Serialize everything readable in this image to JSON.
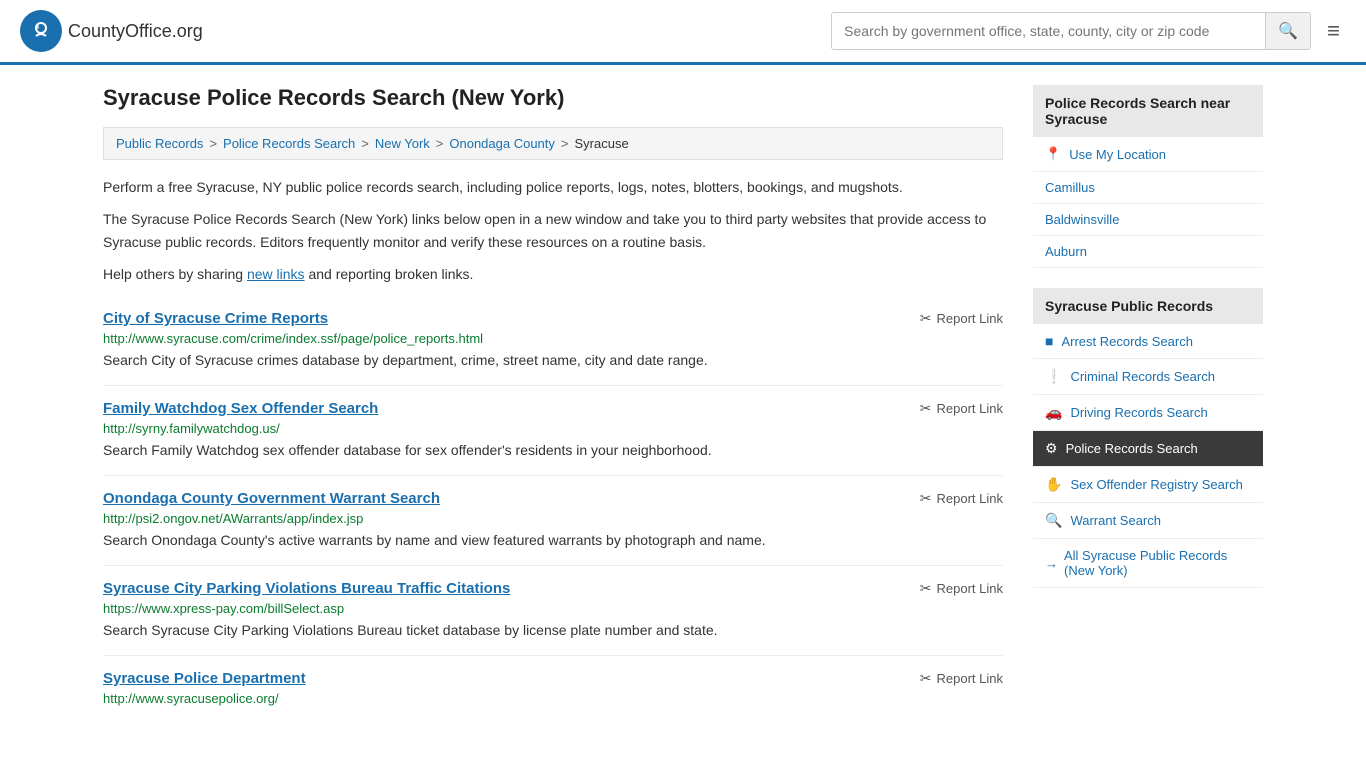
{
  "header": {
    "logo_text": "CountyOffice",
    "logo_suffix": ".org",
    "search_placeholder": "Search by government office, state, county, city or zip code"
  },
  "breadcrumb": {
    "items": [
      "Public Records",
      "Police Records Search",
      "New York",
      "Onondaga County",
      "Syracuse"
    ]
  },
  "page": {
    "title": "Syracuse Police Records Search (New York)",
    "description1": "Perform a free Syracuse, NY public police records search, including police reports, logs, notes, blotters, bookings, and mugshots.",
    "description2": "The Syracuse Police Records Search (New York) links below open in a new window and take you to third party websites that provide access to Syracuse public records. Editors frequently monitor and verify these resources on a routine basis.",
    "description3_before": "Help others by sharing ",
    "description3_link": "new links",
    "description3_after": " and reporting broken links."
  },
  "results": [
    {
      "title": "City of Syracuse Crime Reports",
      "url": "http://www.syracuse.com/crime/index.ssf/page/police_reports.html",
      "desc": "Search City of Syracuse crimes database by department, crime, street name, city and date range.",
      "report_label": "Report Link"
    },
    {
      "title": "Family Watchdog Sex Offender Search",
      "url": "http://syrny.familywatchdog.us/",
      "desc": "Search Family Watchdog sex offender database for sex offender's residents in your neighborhood.",
      "report_label": "Report Link"
    },
    {
      "title": "Onondaga County Government Warrant Search",
      "url": "http://psi2.ongov.net/AWarrants/app/index.jsp",
      "desc": "Search Onondaga County's active warrants by name and view featured warrants by photograph and name.",
      "report_label": "Report Link"
    },
    {
      "title": "Syracuse City Parking Violations Bureau Traffic Citations",
      "url": "https://www.xpress-pay.com/billSelect.asp",
      "desc": "Search Syracuse City Parking Violations Bureau ticket database by license plate number and state.",
      "report_label": "Report Link"
    },
    {
      "title": "Syracuse Police Department",
      "url": "http://www.syracusepolice.org/",
      "desc": "",
      "report_label": "Report Link"
    }
  ],
  "sidebar": {
    "section1_title": "Police Records Search near Syracuse",
    "use_my_location": "Use My Location",
    "nearby_links": [
      "Camillus",
      "Baldwinsville",
      "Auburn"
    ],
    "section2_title": "Syracuse Public Records",
    "public_records_links": [
      {
        "label": "Arrest Records Search",
        "icon": "■",
        "active": false
      },
      {
        "label": "Criminal Records Search",
        "icon": "!",
        "active": false
      },
      {
        "label": "Driving Records Search",
        "icon": "🚗",
        "active": false
      },
      {
        "label": "Police Records Search",
        "icon": "⚙",
        "active": true
      },
      {
        "label": "Sex Offender Registry Search",
        "icon": "✋",
        "active": false
      },
      {
        "label": "Warrant Search",
        "icon": "🔍",
        "active": false
      }
    ],
    "all_records_label": "All Syracuse Public Records (New York)"
  }
}
